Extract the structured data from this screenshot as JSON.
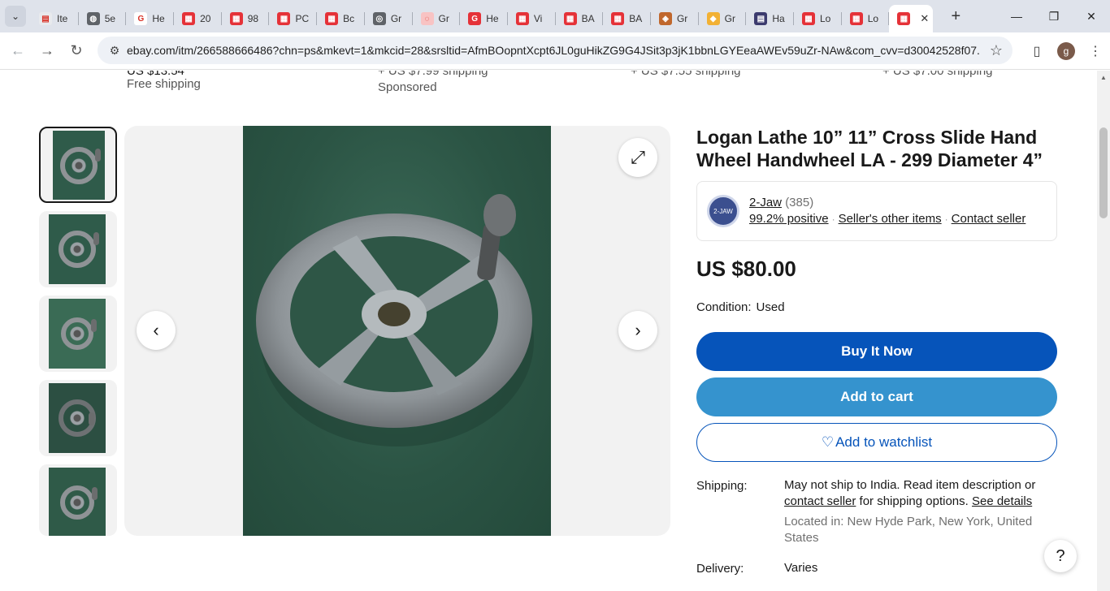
{
  "browser": {
    "tabs": [
      {
        "label": "Ite",
        "color": "#e8eaed",
        "glyph": "▤"
      },
      {
        "label": "5e",
        "color": "#5f6368",
        "glyph": "◍"
      },
      {
        "label": "He",
        "color": "#ffffff",
        "glyph": "G"
      },
      {
        "label": "20",
        "color": "#e53238",
        "glyph": "▦"
      },
      {
        "label": "98",
        "color": "#e53238",
        "glyph": "▦"
      },
      {
        "label": "PC",
        "color": "#e53238",
        "glyph": "▦"
      },
      {
        "label": "Bc",
        "color": "#e53238",
        "glyph": "▦"
      },
      {
        "label": "Gr",
        "color": "#5f6368",
        "glyph": "◎"
      },
      {
        "label": "Gr",
        "color": "#f8c3c3",
        "glyph": "◌"
      },
      {
        "label": "He",
        "color": "#e53238",
        "glyph": "G"
      },
      {
        "label": "Vi",
        "color": "#e53238",
        "glyph": "▦"
      },
      {
        "label": "BA",
        "color": "#e53238",
        "glyph": "▦"
      },
      {
        "label": "BA",
        "color": "#e53238",
        "glyph": "▦"
      },
      {
        "label": "Gr",
        "color": "#c0672c",
        "glyph": "◈"
      },
      {
        "label": "Gr",
        "color": "#f2b134",
        "glyph": "◆"
      },
      {
        "label": "Ha",
        "color": "#3c3b6e",
        "glyph": "▤"
      },
      {
        "label": "Lo",
        "color": "#e53238",
        "glyph": "▦"
      },
      {
        "label": "Lo",
        "color": "#e53238",
        "glyph": "▦"
      }
    ],
    "active_tab_color": "#e53238",
    "url": "ebay.com/itm/266588666486?chn=ps&mkevt=1&mkcid=28&srsltid=AfmBOopntXcpt6JL0guHikZG9G4JSit3p3jK1bbnLGYEeaAWEv59uZr-NAw&com_cvv=d30042528f07...",
    "profile_initial": "g"
  },
  "related": {
    "item1_price": "US $13.54",
    "item1_shipping": "Free shipping",
    "item2_price": "+ US $7.99 shipping",
    "item2_sponsored": "Sponsored",
    "item3_price": "+ US $7.55 shipping",
    "item4_price": "+ US $7.00 shipping"
  },
  "listing": {
    "title": "Logan Lathe 10” 11” Cross Slide Hand Wheel Handwheel LA - 299 Diameter 4”",
    "seller": {
      "logo_text": "2-JAW",
      "name": "2-Jaw",
      "feedback_count": "(385)",
      "positive": "99.2% positive",
      "other_items": "Seller's other items",
      "contact": "Contact seller"
    },
    "price": "US $80.00",
    "condition_label": "Condition:",
    "condition_value": "Used",
    "buy_now": "Buy It Now",
    "add_to_cart": "Add to cart",
    "add_to_watchlist": "Add to watchlist",
    "shipping_label": "Shipping:",
    "shipping_text_1": "May not ship to India. Read item description or",
    "shipping_link": "contact seller",
    "shipping_text_2": "for shipping options.",
    "see_details": "See details",
    "located_in": "Located in: New Hyde Park, New York, United States",
    "delivery_label": "Delivery:",
    "delivery_value": "Varies",
    "help": "?"
  }
}
